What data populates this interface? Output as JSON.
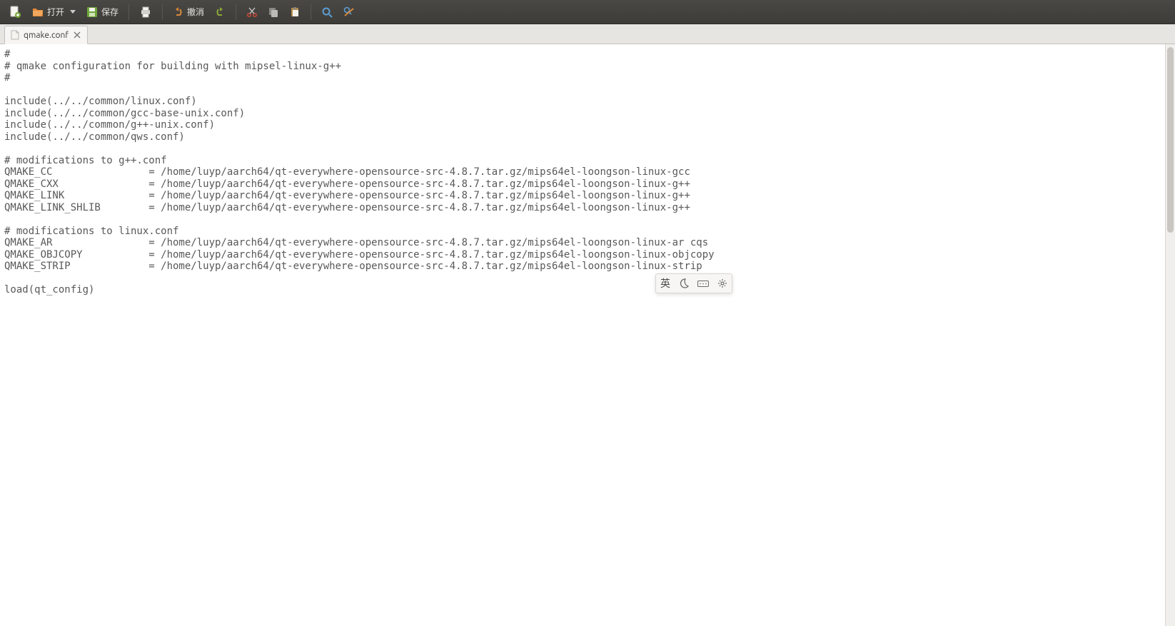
{
  "toolbar": {
    "open_label": "打开",
    "save_label": "保存",
    "undo_label": "撤消"
  },
  "tab": {
    "filename": "qmake.conf"
  },
  "editor": {
    "lines": [
      "#",
      "# qmake configuration for building with mipsel-linux-g++",
      "#",
      "",
      "include(../../common/linux.conf)",
      "include(../../common/gcc-base-unix.conf)",
      "include(../../common/g++-unix.conf)",
      "include(../../common/qws.conf)",
      "",
      "# modifications to g++.conf",
      "QMAKE_CC                = /home/luyp/aarch64/qt-everywhere-opensource-src-4.8.7.tar.gz/mips64el-loongson-linux-gcc",
      "QMAKE_CXX               = /home/luyp/aarch64/qt-everywhere-opensource-src-4.8.7.tar.gz/mips64el-loongson-linux-g++",
      "QMAKE_LINK              = /home/luyp/aarch64/qt-everywhere-opensource-src-4.8.7.tar.gz/mips64el-loongson-linux-g++",
      "QMAKE_LINK_SHLIB        = /home/luyp/aarch64/qt-everywhere-opensource-src-4.8.7.tar.gz/mips64el-loongson-linux-g++",
      "",
      "# modifications to linux.conf",
      "QMAKE_AR                = /home/luyp/aarch64/qt-everywhere-opensource-src-4.8.7.tar.gz/mips64el-loongson-linux-ar cqs",
      "QMAKE_OBJCOPY           = /home/luyp/aarch64/qt-everywhere-opensource-src-4.8.7.tar.gz/mips64el-loongson-linux-objcopy",
      "QMAKE_STRIP             = /home/luyp/aarch64/qt-everywhere-opensource-src-4.8.7.tar.gz/mips64el-loongson-linux-strip",
      "",
      "load(qt_config)"
    ]
  },
  "ime": {
    "lang": "英"
  }
}
